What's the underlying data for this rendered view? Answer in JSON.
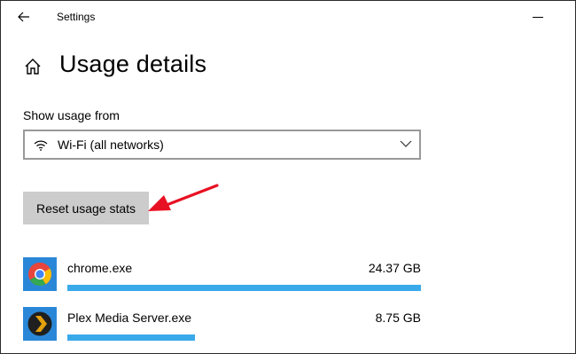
{
  "window": {
    "title": "Settings"
  },
  "page": {
    "title": "Usage details"
  },
  "filter": {
    "label": "Show usage from",
    "selected": "Wi-Fi (all networks)"
  },
  "actions": {
    "reset_label": "Reset usage stats"
  },
  "apps": [
    {
      "name": "chrome.exe",
      "size": "24.37 GB",
      "usage_fraction": 1.0,
      "icon": "chrome-icon"
    },
    {
      "name": "Plex Media Server.exe",
      "size": "8.75 GB",
      "usage_fraction": 0.36,
      "icon": "plex-icon"
    }
  ],
  "colors": {
    "usage_bar": "#3aa9ea",
    "button_bg": "#cccccc",
    "annotation_arrow": "#e81123"
  }
}
